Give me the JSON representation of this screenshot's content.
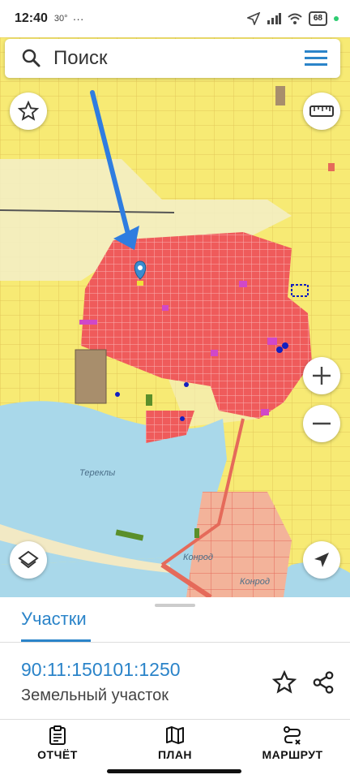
{
  "status_bar": {
    "time": "12:40",
    "temperature": "30°",
    "more": "···",
    "battery": "68"
  },
  "search": {
    "placeholder": "Поиск"
  },
  "map": {
    "village_label": "Тереклы",
    "channel_label_1": "Конрод",
    "channel_label_2": "Конрод",
    "icons": [
      "search-icon",
      "menu-icon",
      "star-icon",
      "ruler-icon",
      "zoom-in-icon",
      "zoom-out-icon",
      "layers-icon",
      "navigation-icon",
      "map-pin-icon"
    ]
  },
  "sheet": {
    "tab_label": "Участки",
    "cadastral_number": "90:11:150101:1250",
    "parcel_type": "Земельный участок"
  },
  "bottom_nav": {
    "report_label": "ОТЧЁТ",
    "plan_label": "ПЛАН",
    "route_label": "МАРШРУТ"
  },
  "colors": {
    "accent": "#2b84c9",
    "parcel_fill": "#ef5b5b",
    "field": "#f7ea74",
    "water": "#a9d8ea"
  }
}
